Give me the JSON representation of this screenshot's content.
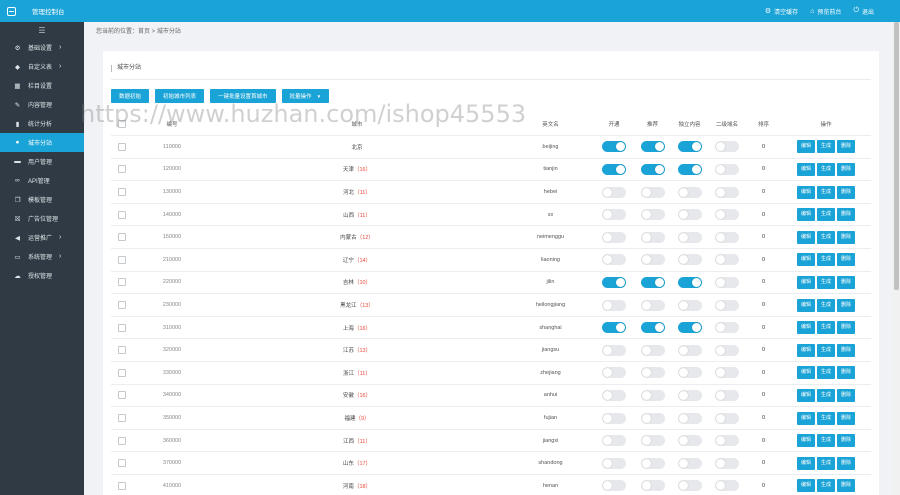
{
  "header": {
    "app_title": "管理控制台",
    "actions": [
      {
        "label": "清空缓存",
        "icon": "gear-icon"
      },
      {
        "label": "预览前台",
        "icon": "home-icon"
      },
      {
        "label": "退出",
        "icon": "power-icon"
      }
    ]
  },
  "sidebar": {
    "toggle_icon": "hamburger-icon",
    "items": [
      {
        "label": "基础设置",
        "icon": "gear-icon",
        "arrow": "›",
        "active": false
      },
      {
        "label": "自定义表",
        "icon": "tag-icon",
        "arrow": "›",
        "active": false
      },
      {
        "label": "栏目设置",
        "icon": "grid-icon",
        "arrow": "",
        "active": false
      },
      {
        "label": "内容管理",
        "icon": "edit-icon",
        "arrow": "",
        "active": false
      },
      {
        "label": "统计分析",
        "icon": "chart-icon",
        "arrow": "",
        "active": false
      },
      {
        "label": "城市分站",
        "icon": "globe-icon",
        "arrow": "",
        "active": true
      },
      {
        "label": "用户管理",
        "icon": "chat-icon",
        "arrow": "",
        "active": false
      },
      {
        "label": "API管理",
        "icon": "link-icon",
        "arrow": "",
        "active": false
      },
      {
        "label": "模板管理",
        "icon": "copy-icon",
        "arrow": "",
        "active": false
      },
      {
        "label": "广告位管理",
        "icon": "close-box-icon",
        "arrow": "",
        "active": false
      },
      {
        "label": "运营推广",
        "icon": "megaphone-icon",
        "arrow": "›",
        "active": false
      },
      {
        "label": "系统管理",
        "icon": "monitor-icon",
        "arrow": "›",
        "active": false
      },
      {
        "label": "授权管理",
        "icon": "cloud-icon",
        "arrow": "",
        "active": false
      }
    ]
  },
  "breadcrumb": "您当前的位置：首页 > 城市分站",
  "panel": {
    "title": "城市分站",
    "toolbar": [
      "数据初始",
      "初始城市列表",
      "一键批量设置首城市",
      "批量操作"
    ],
    "dropdown_icon": "▼"
  },
  "table": {
    "columns": [
      "编号",
      "城市",
      "英文名",
      "开通",
      "推荐",
      "独立内容",
      "二级域名",
      "排序",
      "操作"
    ],
    "row_actions": [
      "编辑",
      "生成",
      "删除"
    ],
    "rows": [
      {
        "code": "110000",
        "city": "北京",
        "count": "",
        "en": "beijing",
        "open": true,
        "recommend": true,
        "independent": true,
        "subdomain": false,
        "sort": "0"
      },
      {
        "code": "120000",
        "city": "天津",
        "count": "（16）",
        "en": "tianjin",
        "open": true,
        "recommend": true,
        "independent": true,
        "subdomain": false,
        "sort": "0"
      },
      {
        "code": "130000",
        "city": "河北",
        "count": "（11）",
        "en": "hebei",
        "open": false,
        "recommend": false,
        "independent": false,
        "subdomain": false,
        "sort": "0"
      },
      {
        "code": "140000",
        "city": "山西",
        "count": "（11）",
        "en": "sx",
        "open": false,
        "recommend": false,
        "independent": false,
        "subdomain": false,
        "sort": "0"
      },
      {
        "code": "150000",
        "city": "内蒙古",
        "count": "（12）",
        "en": "neimenggu",
        "open": false,
        "recommend": false,
        "independent": false,
        "subdomain": false,
        "sort": "0"
      },
      {
        "code": "210000",
        "city": "辽宁",
        "count": "（14）",
        "en": "liaoning",
        "open": false,
        "recommend": false,
        "independent": false,
        "subdomain": false,
        "sort": "0"
      },
      {
        "code": "220000",
        "city": "吉林",
        "count": "（10）",
        "en": "jilin",
        "open": true,
        "recommend": true,
        "independent": true,
        "subdomain": false,
        "sort": "0"
      },
      {
        "code": "230000",
        "city": "黑龙江",
        "count": "（13）",
        "en": "heilongjiang",
        "open": false,
        "recommend": false,
        "independent": false,
        "subdomain": false,
        "sort": "0"
      },
      {
        "code": "310000",
        "city": "上海",
        "count": "（16）",
        "en": "shanghai",
        "open": true,
        "recommend": true,
        "independent": true,
        "subdomain": false,
        "sort": "0"
      },
      {
        "code": "320000",
        "city": "江苏",
        "count": "（13）",
        "en": "jiangsu",
        "open": false,
        "recommend": false,
        "independent": false,
        "subdomain": false,
        "sort": "0"
      },
      {
        "code": "330000",
        "city": "浙江",
        "count": "（11）",
        "en": "zhejiang",
        "open": false,
        "recommend": false,
        "independent": false,
        "subdomain": false,
        "sort": "0"
      },
      {
        "code": "340000",
        "city": "安徽",
        "count": "（16）",
        "en": "anhui",
        "open": false,
        "recommend": false,
        "independent": false,
        "subdomain": false,
        "sort": "0"
      },
      {
        "code": "350000",
        "city": "福建",
        "count": "（9）",
        "en": "fujian",
        "open": false,
        "recommend": false,
        "independent": false,
        "subdomain": false,
        "sort": "0"
      },
      {
        "code": "360000",
        "city": "江西",
        "count": "（11）",
        "en": "jiangxi",
        "open": false,
        "recommend": false,
        "independent": false,
        "subdomain": false,
        "sort": "0"
      },
      {
        "code": "370000",
        "city": "山东",
        "count": "（17）",
        "en": "shandong",
        "open": false,
        "recommend": false,
        "independent": false,
        "subdomain": false,
        "sort": "0"
      },
      {
        "code": "410000",
        "city": "河南",
        "count": "（18）",
        "en": "henan",
        "open": false,
        "recommend": false,
        "independent": false,
        "subdomain": false,
        "sort": "0"
      }
    ]
  },
  "watermark": "https://www.huzhan.com/ishop45553",
  "colors": {
    "accent": "#1aa3d6",
    "sidebar": "#2f3a44",
    "count_text": "#e84a3a"
  }
}
